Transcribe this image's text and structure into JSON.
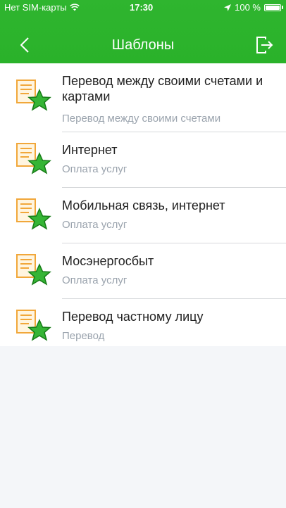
{
  "status_bar": {
    "carrier": "Нет SIM-карты",
    "time": "17:30",
    "battery": "100 %",
    "wifi_icon": "wifi-icon",
    "location_icon": "location-arrow-icon",
    "battery_icon": "battery-icon"
  },
  "nav": {
    "title": "Шаблоны",
    "back_icon": "back-chevron-icon",
    "exit_icon": "exit-icon",
    "color": "#2ab22a"
  },
  "templates": [
    {
      "title": "Перевод между своими счетами и картами",
      "subtitle": "Перевод между своими счетами",
      "icon": "template-star-icon"
    },
    {
      "title": "Интернет",
      "subtitle": "Оплата услуг",
      "icon": "template-star-icon"
    },
    {
      "title": "Мобильная связь, интернет",
      "subtitle": "Оплата услуг",
      "icon": "template-star-icon"
    },
    {
      "title": "Мосэнергосбыт",
      "subtitle": "Оплата услуг",
      "icon": "template-star-icon"
    },
    {
      "title": "Перевод частному лицу",
      "subtitle": "Перевод",
      "icon": "template-star-icon"
    }
  ]
}
